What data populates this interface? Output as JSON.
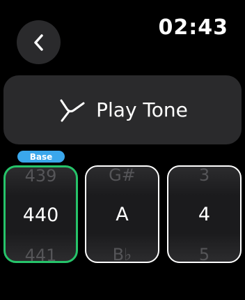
{
  "header": {
    "time": "02:43"
  },
  "play": {
    "label": "Play Tone"
  },
  "badge": {
    "label": "Base"
  },
  "pickers": {
    "frequency": {
      "prev": "439",
      "current": "440",
      "next": "441"
    },
    "note": {
      "prev": "G#",
      "current": "A",
      "next": "B♭"
    },
    "octave": {
      "prev": "3",
      "current": "4",
      "next": "5"
    }
  },
  "colors": {
    "selected_border": "#26c46a",
    "badge_bg": "#3aa7ec"
  },
  "icons": {
    "back": "chevron-left-icon",
    "play": "tuning-fork-icon"
  }
}
